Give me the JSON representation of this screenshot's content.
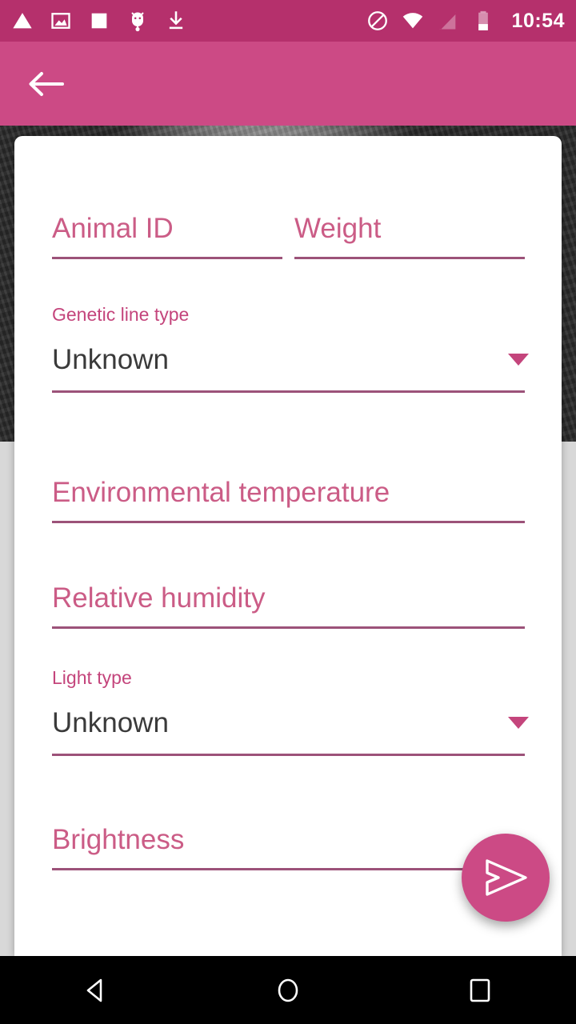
{
  "status_bar": {
    "background": "#b5306c",
    "time": "10:54",
    "left_icons": [
      {
        "name": "warning-triangle-icon"
      },
      {
        "name": "image-icon"
      },
      {
        "name": "square-icon"
      },
      {
        "name": "android-debug-icon"
      },
      {
        "name": "download-icon"
      }
    ],
    "right_icons": [
      {
        "name": "do-not-disturb-icon"
      },
      {
        "name": "wifi-icon"
      },
      {
        "name": "signal-off-icon"
      },
      {
        "name": "battery-low-icon"
      }
    ]
  },
  "app_bar": {
    "background": "#cc4a85",
    "back_icon": "back-arrow-icon",
    "title": ""
  },
  "theme": {
    "accent": "#cc4a85",
    "placeholder": "#cb5c86",
    "caption": "#c4457c",
    "underline": "#9c5279",
    "value_text": "#3a3a3a",
    "card_background": "#ffffff"
  },
  "form": {
    "fields": {
      "animal_id": {
        "placeholder": "Animal ID",
        "value": ""
      },
      "weight": {
        "placeholder": "Weight",
        "value": ""
      },
      "temperature": {
        "placeholder": "Environmental temperature",
        "value": ""
      },
      "humidity": {
        "placeholder": "Relative humidity",
        "value": ""
      },
      "brightness": {
        "placeholder": "Brightness",
        "value": ""
      }
    },
    "spinners": {
      "genetic_line_type": {
        "caption": "Genetic line type",
        "selected": "Unknown",
        "arrow_icon": "chevron-down-icon"
      },
      "light_type": {
        "caption": "Light type",
        "selected": "Unknown",
        "arrow_icon": "chevron-down-icon"
      }
    }
  },
  "fab": {
    "icon": "send-icon",
    "label": "",
    "color": "#cc4a85"
  },
  "nav_bar": {
    "background": "#000000",
    "buttons": [
      {
        "name": "nav-back-icon"
      },
      {
        "name": "nav-home-icon"
      },
      {
        "name": "nav-recents-icon"
      }
    ]
  }
}
